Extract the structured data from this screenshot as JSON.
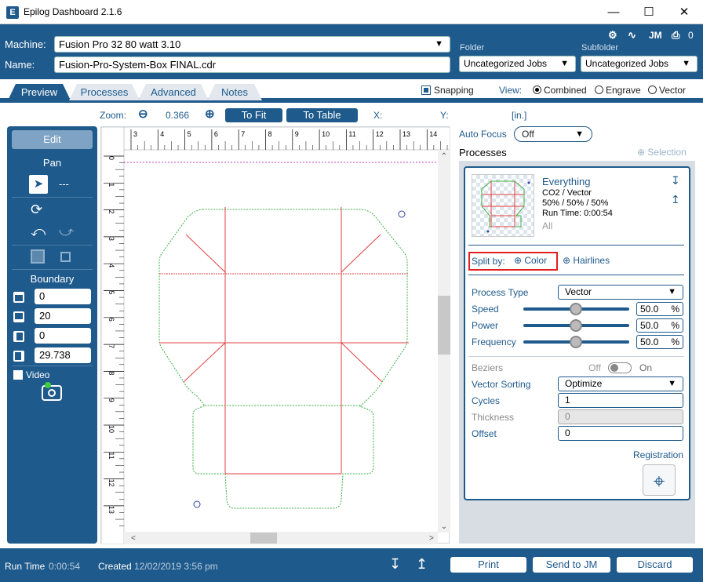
{
  "window": {
    "title": "Epilog Dashboard 2.1.6",
    "app_icon": "E",
    "icons": [
      "minimize-icon",
      "maximize-icon",
      "close-icon"
    ]
  },
  "header": {
    "machine_label": "Machine:",
    "machine_value": "Fusion Pro 32 80 watt 3.10",
    "name_label": "Name:",
    "name_value": "Fusion-Pro-System-Box FINAL.cdr",
    "folder_label": "Folder",
    "folder_value": "Uncategorized Jobs",
    "subfolder_label": "Subfolder",
    "subfolder_value": "Uncategorized Jobs",
    "user_initials": "JM",
    "print_count": "0"
  },
  "tabs": [
    {
      "label": "Preview",
      "active": true
    },
    {
      "label": "Processes",
      "active": false
    },
    {
      "label": "Advanced",
      "active": false
    },
    {
      "label": "Notes",
      "active": false
    }
  ],
  "options": {
    "snapping_label": "Snapping",
    "snapping_checked": true,
    "view_label": "View:",
    "view_options": [
      "Combined",
      "Engrave",
      "Vector"
    ],
    "view_selected": "Combined"
  },
  "zoombar": {
    "zoom_label": "Zoom:",
    "zoom_value": "0.366",
    "to_fit_label": "To Fit",
    "to_table_label": "To Table",
    "x_label": "X:",
    "y_label": "Y:",
    "units": "[in.]"
  },
  "left_panel": {
    "edit_label": "Edit",
    "pan_label": "Pan",
    "pan_value": "---",
    "boundary_label": "Boundary",
    "boundary_values": [
      "0",
      "20",
      "0",
      "29.738"
    ],
    "video_label": "Video",
    "video_checked": false
  },
  "ruler": {
    "h_ticks": [
      "3",
      "4",
      "5",
      "6",
      "7",
      "8",
      "9",
      "10",
      "11",
      "12",
      "13",
      "14"
    ],
    "v_ticks": [
      "0",
      "1",
      "2",
      "3",
      "4",
      "5",
      "6",
      "7",
      "8",
      "9",
      "10",
      "11",
      "12",
      "13"
    ]
  },
  "right_panel": {
    "auto_focus_label": "Auto Focus",
    "auto_focus_value": "Off",
    "processes_title": "Processes",
    "selection_label": "Selection",
    "process": {
      "name": "Everything",
      "type_line": "CO2 / Vector",
      "settings_line": "50% / 50% / 50%",
      "runtime_line": "Run Time: 0:00:54",
      "scope": "All"
    },
    "split_by_label": "Split by:",
    "split_color_label": "Color",
    "split_hairlines_label": "Hairlines",
    "process_type_label": "Process Type",
    "process_type_value": "Vector",
    "speed_label": "Speed",
    "speed_value": "50.0",
    "power_label": "Power",
    "power_value": "50.0",
    "frequency_label": "Frequency",
    "frequency_value": "50.0",
    "percent": "%",
    "beziers_label": "Beziers",
    "beziers_off": "Off",
    "beziers_on": "On",
    "vector_sorting_label": "Vector Sorting",
    "vector_sorting_value": "Optimize",
    "cycles_label": "Cycles",
    "cycles_value": "1",
    "thickness_label": "Thickness",
    "thickness_value": "0",
    "offset_label": "Offset",
    "offset_value": "0",
    "registration_label": "Registration"
  },
  "status": {
    "run_time_label": "Run Time",
    "run_time_value": "0:00:54",
    "created_label": "Created",
    "created_value": "12/02/2019 3:56 pm",
    "print_label": "Print",
    "send_label": "Send to JM",
    "discard_label": "Discard"
  },
  "colors": {
    "accent": "#1f5a8c",
    "cut_red": "#e04040",
    "score_green": "#3cb043",
    "highlight": "#e02020"
  }
}
